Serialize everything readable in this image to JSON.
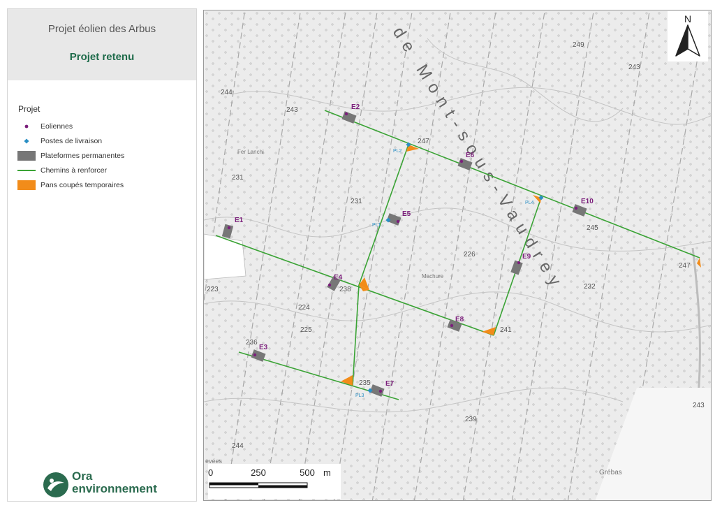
{
  "header": {
    "title": "Projet éolien des Arbus",
    "subtitle": "Projet retenu"
  },
  "legend": {
    "title": "Projet",
    "items": [
      {
        "label": "Eoliennes",
        "symbol": "dot-icon",
        "color": "#7b1f7b"
      },
      {
        "label": "Postes de livraison",
        "symbol": "diamond-icon",
        "color": "#2a8fc4"
      },
      {
        "label": "Plateformes permanentes",
        "symbol": "gray-rect-icon",
        "color": "#777777"
      },
      {
        "label": "Chemins à renforcer",
        "symbol": "green-line-icon",
        "color": "#3aa335"
      },
      {
        "label": "Pans coupés temporaires",
        "symbol": "orange-rect-icon",
        "color": "#f28c1a"
      }
    ]
  },
  "logo": {
    "line1": "Ora",
    "line2": "environnement"
  },
  "map": {
    "turbines": [
      "E1",
      "E2",
      "E3",
      "E4",
      "E5",
      "E6",
      "E7",
      "E8",
      "E9",
      "E10"
    ],
    "delivery_posts": [
      "PL1",
      "PL2",
      "PL3",
      "PL4"
    ],
    "place_labels": {
      "lieu_dit_1": "de Mont-sous-Vaudrey",
      "lieu_dit_2": "Machure",
      "lieu_dit_3": "Grébas",
      "lieu_dit_4": "Fer Lanchi",
      "lieu_dit_5": "evées"
    },
    "elevations": [
      "244",
      "243",
      "231",
      "231",
      "226",
      "223",
      "224",
      "225",
      "238",
      "236",
      "235",
      "239",
      "241",
      "232",
      "245",
      "247",
      "247",
      "247",
      "249",
      "243",
      "243",
      "244"
    ]
  },
  "north_arrow": {
    "label": "N"
  },
  "scale_bar": {
    "ticks": [
      "0",
      "250",
      "500"
    ],
    "unit": "m"
  },
  "colors": {
    "title_green": "#1e6b4a",
    "turbine": "#7b1f7b",
    "post": "#2a8fc4",
    "platform": "#777777",
    "road": "#3aa335",
    "cut": "#f28c1a"
  }
}
